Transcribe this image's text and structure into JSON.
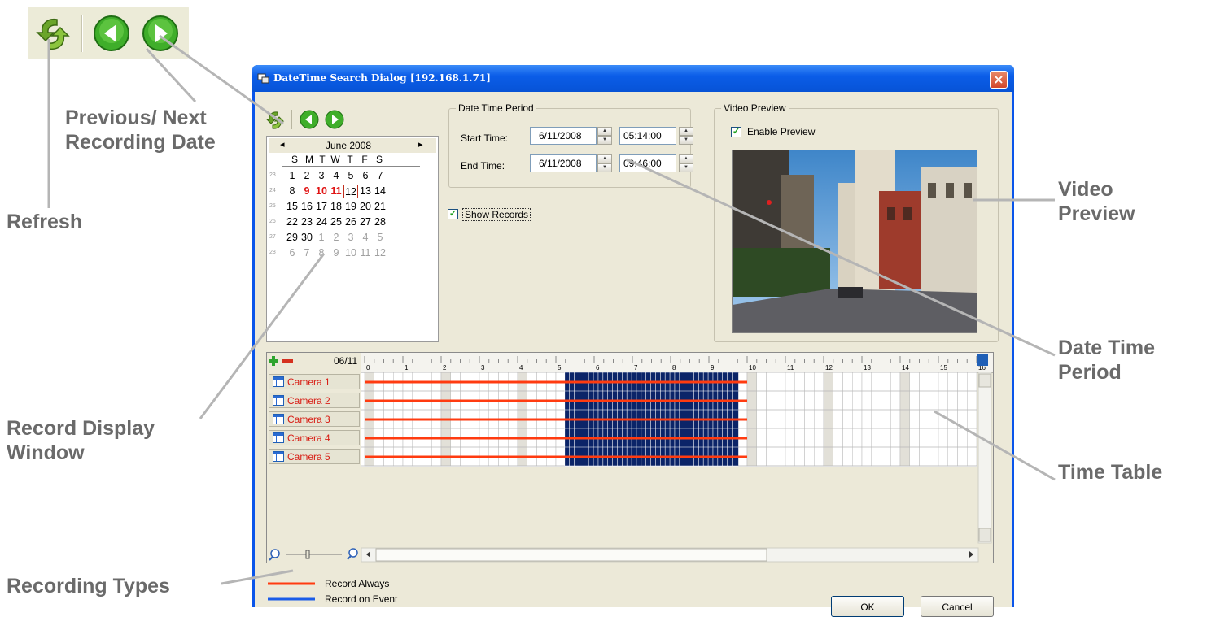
{
  "callouts": {
    "previous_next": [
      "Previous/ Next",
      "Recording Date"
    ],
    "refresh": "Refresh",
    "record_display": [
      "Record Display",
      "Window"
    ],
    "recording_types": "Recording Types",
    "video_preview": [
      "Video",
      "Preview"
    ],
    "date_time_period": [
      "Date Time",
      "Period"
    ],
    "time_table": "Time Table"
  },
  "dialog": {
    "title": "DateTime Search Dialog  [192.168.1.71]",
    "close_label": "×"
  },
  "calendar": {
    "prev_arrow": "◂",
    "next_arrow": "▸",
    "month_label": "June 2008",
    "weekdays": [
      "S",
      "M",
      "T",
      "W",
      "T",
      "F",
      "S"
    ],
    "week_numbers": [
      "23",
      "24",
      "25",
      "26",
      "27",
      "28"
    ],
    "weeks": [
      [
        "1",
        "2",
        "3",
        "4",
        "5",
        "6",
        "7"
      ],
      [
        "8",
        "9",
        "10",
        "11",
        "12",
        "13",
        "14"
      ],
      [
        "15",
        "16",
        "17",
        "18",
        "19",
        "20",
        "21"
      ],
      [
        "22",
        "23",
        "24",
        "25",
        "26",
        "27",
        "28"
      ],
      [
        "29",
        "30",
        "1",
        "2",
        "3",
        "4",
        "5"
      ],
      [
        "6",
        "7",
        "8",
        "9",
        "10",
        "11",
        "12"
      ]
    ],
    "record_days": [
      "9",
      "10",
      "11"
    ],
    "selected_day": "12"
  },
  "date_time_period": {
    "legend": "Date Time Period",
    "start_label": "Start Time:",
    "start_date": "6/11/2008",
    "start_time": "05:14:00",
    "end_label": "End Time:",
    "end_date": "6/11/2008",
    "end_time": "09:46:00"
  },
  "show_records": {
    "label": "Show Records",
    "checked": true
  },
  "video_preview": {
    "legend": "Video Preview",
    "enable_label": "Enable Preview",
    "enabled": true
  },
  "timeline": {
    "date_label": "06/11",
    "hour_labels": [
      "0",
      "1",
      "2",
      "3",
      "4",
      "5",
      "6",
      "7",
      "8",
      "9",
      "10",
      "11",
      "12",
      "13",
      "14",
      "15",
      "16"
    ],
    "cameras": [
      "Camera 1",
      "Camera 2",
      "Camera 3",
      "Camera 4",
      "Camera 5"
    ],
    "selection_start_hour": 5.23,
    "selection_end_hour": 9.77,
    "record_always_end_hour": 10
  },
  "legend": {
    "record_always": "Record Always",
    "record_always_color": "#ff3b10",
    "record_event": "Record on Event",
    "record_event_color": "#1a5ce8"
  },
  "buttons": {
    "ok": "OK",
    "cancel": "Cancel"
  }
}
